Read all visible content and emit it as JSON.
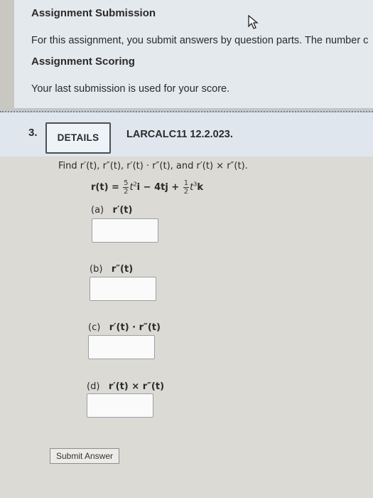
{
  "submission": {
    "heading": "Assignment Submission",
    "text": "For this assignment, you submit answers by question parts. The number c"
  },
  "scoring": {
    "heading": "Assignment Scoring",
    "text": "Your last submission is used for your score."
  },
  "question": {
    "number": "3.",
    "details_label": "DETAILS",
    "reference": "LARCALC11 12.2.023.",
    "prompt": "Find r′(t), r″(t), r′(t) · r″(t), and r′(t) × r″(t).",
    "equation": {
      "lhs": "r(t) =",
      "frac1_num": "5",
      "frac1_den": "2",
      "term1": "t",
      "exp1": "2",
      "i": "i",
      "middle": " − 4tj + ",
      "frac2_num": "1",
      "frac2_den": "2",
      "term2": "t",
      "exp2": "3",
      "k": "k"
    },
    "parts": [
      {
        "label": "(a)",
        "expr": "r′(t)"
      },
      {
        "label": "(b)",
        "expr": "r″(t)"
      },
      {
        "label": "(c)",
        "expr": "r′(t) · r″(t)"
      },
      {
        "label": "(d)",
        "expr": "r′(t) × r″(t)"
      }
    ],
    "submit_label": "Submit Answer"
  }
}
